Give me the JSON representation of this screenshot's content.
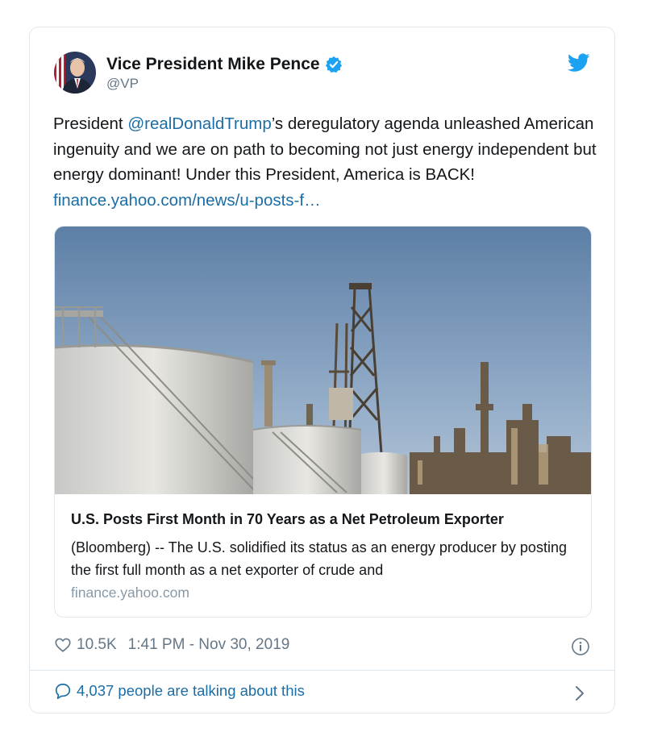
{
  "tweet": {
    "author_name": "Vice President Mike Pence",
    "handle": "@VP",
    "text_before_mention": "President ",
    "mention": "@realDonaldTrump",
    "text_after_mention": "’s deregulatory agenda unleashed American ingenuity and we are on path to becoming not just energy independent but energy dominant! Under this President, America is BACK! ",
    "link_text": "finance.yahoo.com/news/u-posts-f…",
    "likes": "10.5K",
    "timestamp": "1:41 PM - Nov 30, 2019",
    "talking": "4,037 people are talking about this"
  },
  "card": {
    "title": "U.S. Posts First Month in 70 Years as a Net Petroleum Exporter",
    "description": "(Bloomberg) -- The U.S. solidified its status as an energy producer by posting the first full month as a net exporter of crude and",
    "domain": "finance.yahoo.com"
  },
  "icons": {
    "verified": "verified-badge-icon",
    "twitter": "twitter-bird-icon",
    "like": "heart-icon",
    "info": "info-icon",
    "reply": "speech-bubble-icon",
    "chevron": "chevron-right-icon"
  },
  "colors": {
    "link": "#1b6da6",
    "twitter_blue": "#1da1f2",
    "muted": "#657786",
    "border": "#e1e8ed"
  }
}
